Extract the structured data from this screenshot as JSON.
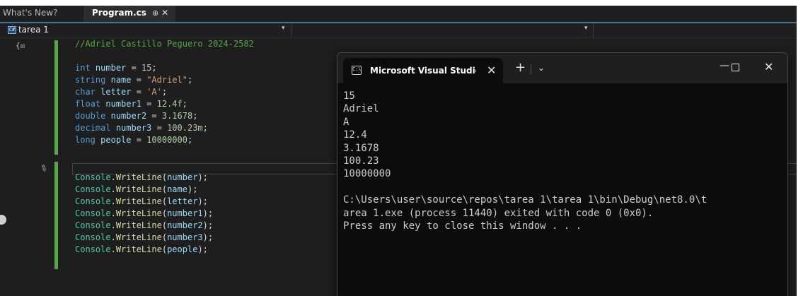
{
  "tabs": {
    "whats_new": "What's New?",
    "program": "Program.cs",
    "pin_glyph": "⊕",
    "close_glyph": "✕"
  },
  "navbar": {
    "project_icon": "C#",
    "project": "tarea 1",
    "dropdown_glyph": "▾"
  },
  "editor": {
    "scope_glyph": "{☒",
    "brush_icon": "paintbrush-icon",
    "comment": "//Adriel Castillo Peguero 2024-2582",
    "declarations": [
      {
        "type": "int",
        "name": "number",
        "value": "15"
      },
      {
        "type": "string",
        "name": "name",
        "value": "\"Adriel\""
      },
      {
        "type": "char",
        "name": "letter",
        "value": "'A'"
      },
      {
        "type": "float",
        "name": "number1",
        "value": "12.4f"
      },
      {
        "type": "double",
        "name": "number2",
        "value": "3.1678"
      },
      {
        "type": "decimal",
        "name": "number3",
        "value": "100.23m"
      },
      {
        "type": "long",
        "name": "people",
        "value": "10000000"
      }
    ],
    "console_class": "Console",
    "writeline_method": "WriteLine",
    "writeline_args": [
      "number",
      "name",
      "letter",
      "number1",
      "number2",
      "number3",
      "people"
    ]
  },
  "console": {
    "icon": "C:\\",
    "title": "Microsoft Visual Studio Debug Console",
    "tab_close_glyph": "✕",
    "new_tab_glyph": "+",
    "dropdown_glyph": "⌄",
    "min_glyph": "—",
    "close_glyph": "✕",
    "output": "15\nAdriel\nA\n12.4\n3.1678\n100.23\n10000000\n\nC:\\Users\\user\\source\\repos\\tarea 1\\tarea 1\\bin\\Debug\\net8.0\\t\narea 1.exe (process 11440) exited with code 0 (0x0).\nPress any key to close this window . . ."
  }
}
